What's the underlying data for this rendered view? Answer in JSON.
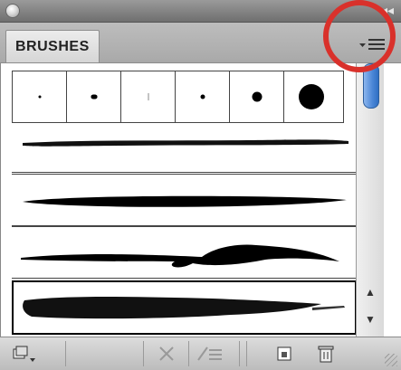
{
  "panel": {
    "tab_label": "BRUSHES",
    "icons": {
      "close": "close-icon",
      "collapse": "double-arrow-icon",
      "menu": "panel-menu-icon"
    }
  },
  "brush_list": {
    "calligraphic_dabs": [
      "dab-1",
      "dab-2",
      "dab-3",
      "dab-4",
      "dab-5",
      "dab-6"
    ],
    "strokes": [
      "thin-charcoal-stroke",
      "thick-tapered-stroke",
      "decorative-swash-stroke",
      "rough-paint-stroke"
    ],
    "selected_stroke": "rough-paint-stroke"
  },
  "bottom_toolbar": {
    "buttons": [
      "brush-libraries-menu-icon",
      "remove-brush-stroke-icon",
      "options-of-selected-object-icon",
      "new-brush-icon",
      "delete-brush-icon"
    ]
  },
  "annotation": {
    "highlight_color": "#d9312b"
  }
}
